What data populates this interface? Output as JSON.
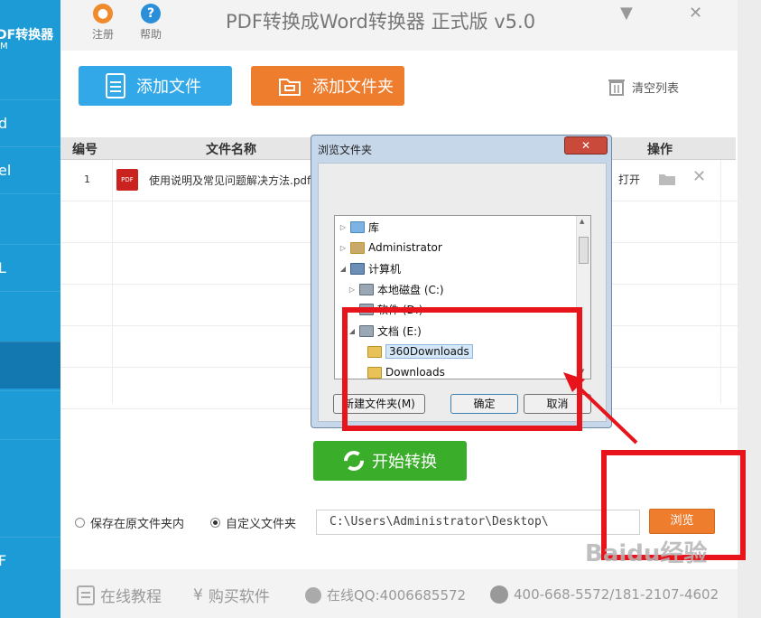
{
  "app": {
    "title": "PDF转换成Word转换器 正式版 v5.0",
    "register_label": "注册",
    "help_label": "帮助",
    "minimize_glyph": "▼",
    "close_glyph": "✕"
  },
  "sidebar": {
    "title": "DF转换器",
    "subtitle": "M",
    "items": [
      {
        "label": "d"
      },
      {
        "label": "el"
      },
      {
        "label": ""
      },
      {
        "label": "L"
      },
      {
        "label": ""
      },
      {
        "label": ""
      },
      {
        "label": ""
      },
      {
        "label": ""
      },
      {
        "label": "F"
      }
    ],
    "active_index": 5
  },
  "toolbar": {
    "add_file_label": "添加文件",
    "add_folder_label": "添加文件夹",
    "clear_list_label": "清空列表"
  },
  "table": {
    "headers": {
      "number": "编号",
      "filename": "文件名称",
      "action": "操作"
    },
    "rows": [
      {
        "number": "1",
        "filename": "使用说明及常见问题解决方法.pdf",
        "icon_text": "PDF",
        "open_label": "打开"
      }
    ]
  },
  "start_button": {
    "label": "开始转换"
  },
  "output": {
    "option_original": "保存在原文件夹内",
    "option_custom": "自定义文件夹",
    "selected": "custom",
    "path": "C:\\Users\\Administrator\\Desktop\\",
    "browse_label": "浏览"
  },
  "footer": {
    "tutorial_label": "在线教程",
    "buy_label": "购买软件",
    "qq_label": "在线QQ:4006685572",
    "phone_label": "400-668-5572/181-2107-4602"
  },
  "dialog": {
    "title": "浏览文件夹",
    "tree": [
      {
        "label": "库",
        "level": 0,
        "expanded": false
      },
      {
        "label": "Administrator",
        "level": 0,
        "expanded": false
      },
      {
        "label": "计算机",
        "level": 0,
        "expanded": true
      },
      {
        "label": "本地磁盘 (C:)",
        "level": 1,
        "expanded": false
      },
      {
        "label": "软件 (D:)",
        "level": 1,
        "expanded": false
      },
      {
        "label": "文档 (E:)",
        "level": 1,
        "expanded": true
      },
      {
        "label": "360Downloads",
        "level": 2,
        "selected": true
      },
      {
        "label": "Downloads",
        "level": 2
      }
    ],
    "new_folder_label": "新建文件夹(M)",
    "ok_label": "确定",
    "cancel_label": "取消"
  },
  "watermark": "Baidu经验",
  "colors": {
    "sidebar": "#1c9bd6",
    "add_file": "#33a8e8",
    "add_folder": "#ee7d2e",
    "start": "#3aad2a",
    "browse": "#ee7d2e",
    "annotation": "#e8141b"
  }
}
